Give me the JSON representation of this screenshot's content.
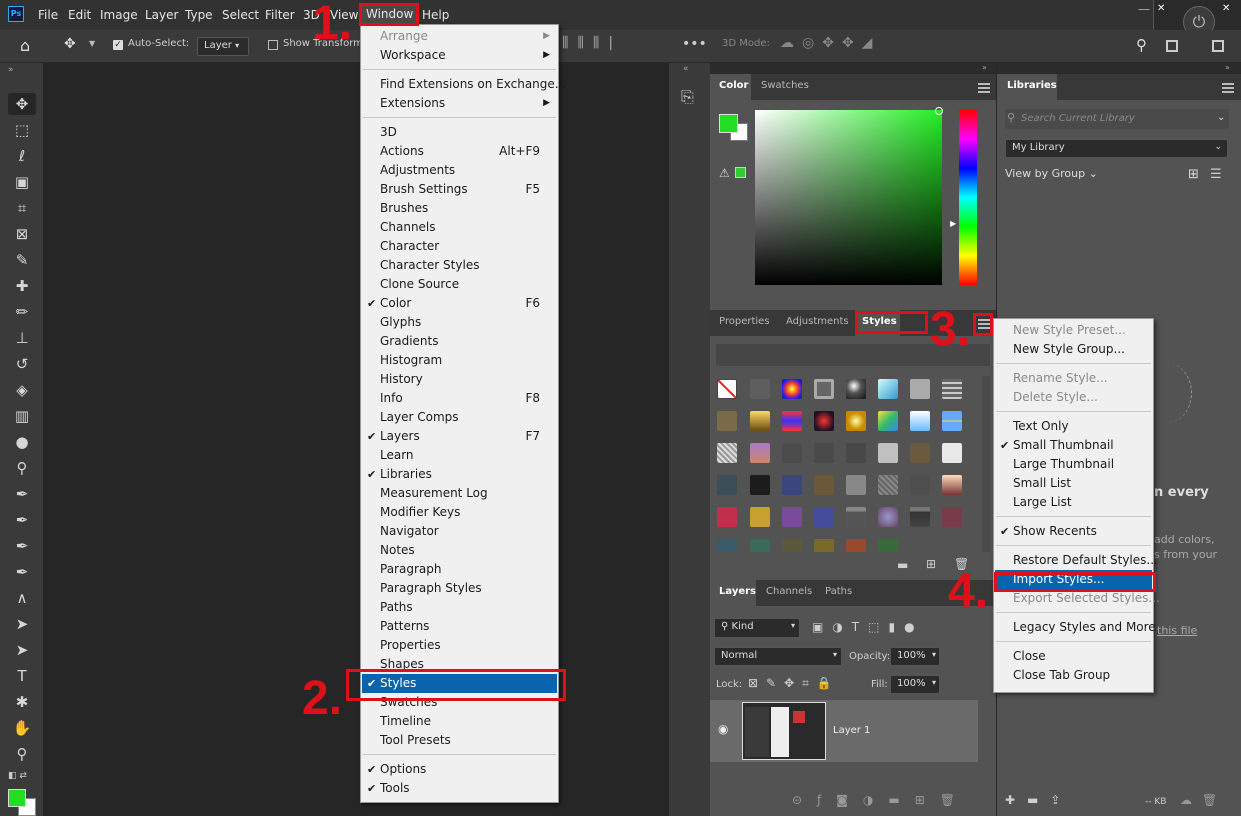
{
  "menubar": {
    "app_icon": "Ps",
    "items": [
      "File",
      "Edit",
      "Image",
      "Layer",
      "Type",
      "Select",
      "Filter",
      "3D",
      "View",
      "Window",
      "Help"
    ]
  },
  "options": {
    "auto_select": "Auto-Select:",
    "layer_dropdown": "Layer",
    "show_transform": "Show Transform",
    "mode_3d": "3D Mode:"
  },
  "window_menu": {
    "items": [
      {
        "label": "Arrange",
        "disabled": true,
        "submenu": true
      },
      {
        "label": "Workspace",
        "submenu": true
      },
      {
        "sep": true
      },
      {
        "label": "Find Extensions on Exchange..."
      },
      {
        "label": "Extensions",
        "submenu": true
      },
      {
        "sep": true
      },
      {
        "label": "3D"
      },
      {
        "label": "Actions",
        "shortcut": "Alt+F9"
      },
      {
        "label": "Adjustments"
      },
      {
        "label": "Brush Settings",
        "shortcut": "F5"
      },
      {
        "label": "Brushes"
      },
      {
        "label": "Channels"
      },
      {
        "label": "Character"
      },
      {
        "label": "Character Styles"
      },
      {
        "label": "Clone Source"
      },
      {
        "label": "Color",
        "shortcut": "F6",
        "checked": true
      },
      {
        "label": "Glyphs"
      },
      {
        "label": "Gradients"
      },
      {
        "label": "Histogram"
      },
      {
        "label": "History"
      },
      {
        "label": "Info",
        "shortcut": "F8"
      },
      {
        "label": "Layer Comps"
      },
      {
        "label": "Layers",
        "shortcut": "F7",
        "checked": true
      },
      {
        "label": "Learn"
      },
      {
        "label": "Libraries",
        "checked": true
      },
      {
        "label": "Measurement Log"
      },
      {
        "label": "Modifier Keys"
      },
      {
        "label": "Navigator"
      },
      {
        "label": "Notes"
      },
      {
        "label": "Paragraph"
      },
      {
        "label": "Paragraph Styles"
      },
      {
        "label": "Paths"
      },
      {
        "label": "Patterns"
      },
      {
        "label": "Properties"
      },
      {
        "label": "Shapes"
      },
      {
        "label": "Styles",
        "checked": true,
        "highlighted": true
      },
      {
        "label": "Swatches"
      },
      {
        "label": "Timeline"
      },
      {
        "label": "Tool Presets"
      },
      {
        "sep": true
      },
      {
        "label": "Options",
        "checked": true
      },
      {
        "label": "Tools",
        "checked": true
      }
    ]
  },
  "styles_menu": {
    "items": [
      {
        "label": "New Style Preset...",
        "disabled": true
      },
      {
        "label": "New Style Group..."
      },
      {
        "sep": true
      },
      {
        "label": "Rename Style...",
        "disabled": true
      },
      {
        "label": "Delete Style...",
        "disabled": true
      },
      {
        "sep": true
      },
      {
        "label": "Text Only"
      },
      {
        "label": "Small Thumbnail",
        "checked": true
      },
      {
        "label": "Large Thumbnail"
      },
      {
        "label": "Small List"
      },
      {
        "label": "Large List"
      },
      {
        "sep": true
      },
      {
        "label": "Show Recents",
        "checked": true
      },
      {
        "sep": true
      },
      {
        "label": "Restore Default Styles..."
      },
      {
        "label": "Import Styles...",
        "highlighted": true
      },
      {
        "label": "Export Selected Styles...",
        "disabled": true
      },
      {
        "sep": true
      },
      {
        "label": "Legacy Styles and More"
      },
      {
        "sep": true
      },
      {
        "label": "Close"
      },
      {
        "label": "Close Tab Group"
      }
    ]
  },
  "color_panel": {
    "tabs": [
      "Color",
      "Swatches"
    ],
    "foreground": "#22dd22",
    "hue_color": "#22ee22"
  },
  "styles_panel": {
    "tabs": [
      "Properties",
      "Adjustments",
      "Styles"
    ]
  },
  "layers_panel": {
    "tabs": [
      "Layers",
      "Channels",
      "Paths"
    ],
    "kind": "Kind",
    "blend": "Normal",
    "opacity_label": "Opacity:",
    "opacity": "100%",
    "lock_label": "Lock:",
    "fill_label": "Fill:",
    "fill": "100%",
    "layer_name": "Layer 1"
  },
  "libraries": {
    "tab": "Libraries",
    "search_placeholder": "Search Current Library",
    "library": "My Library",
    "view_by": "View by Group",
    "partial_text": [
      "n every",
      "add colors,",
      "s from your",
      "this file"
    ],
    "size": "-- KB"
  },
  "annotations": [
    "1.",
    "2.",
    "3.",
    "4."
  ]
}
